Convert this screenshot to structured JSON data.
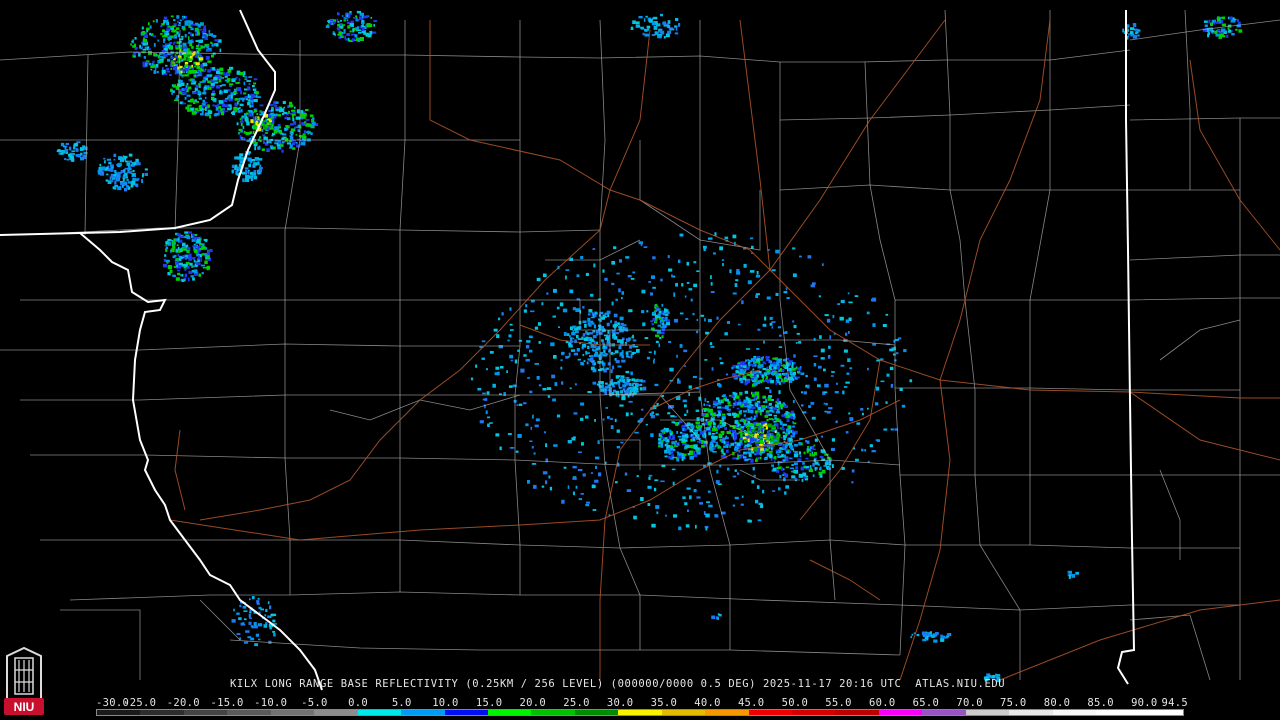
{
  "product": {
    "caption": "KILX LONG RANGE BASE REFLECTIVITY (0.25KM / 256 LEVEL) (000000/0000 0.5 DEG) 2025-11-17 20:16 UTC  ATLAS.NIU.EDU",
    "radar_site": "KILX",
    "scan_time": "2025-11-17 20:16 UTC",
    "elevation": "0.5 DEG",
    "source": "ATLAS.NIU.EDU"
  },
  "logo": {
    "text": "NIU",
    "icon": "university-tower-icon",
    "bg_color": "#c8102e"
  },
  "legend": {
    "ticks": [
      "-30.0",
      "-25.0",
      "-20.0",
      "-15.0",
      "-10.0",
      "-5.0",
      "0.0",
      "5.0",
      "10.0",
      "15.0",
      "20.0",
      "25.0",
      "30.0",
      "35.0",
      "40.0",
      "45.0",
      "50.0",
      "55.0",
      "60.0",
      "65.0",
      "70.0",
      "75.0",
      "80.0",
      "85.0",
      "90.0",
      "94.5"
    ],
    "colors": [
      "#1a1a1a",
      "#2e2e2e",
      "#444444",
      "#5a5a5a",
      "#727272",
      "#8c8c8c",
      "#00e8e8",
      "#009cf4",
      "#0010f4",
      "#00f400",
      "#00c000",
      "#008c00",
      "#f8f400",
      "#e4bc00",
      "#f89800",
      "#f00000",
      "#d40000",
      "#bc0000",
      "#f800f8",
      "#9854c4",
      "#cccccc",
      "#e8e8e8",
      "#f8f8f8",
      "#ffffff",
      "#ffffff"
    ]
  },
  "map": {
    "state_line_color": "#ffffff",
    "county_line_color": "#b4b4b4",
    "highway_color": "#b4582c"
  }
}
